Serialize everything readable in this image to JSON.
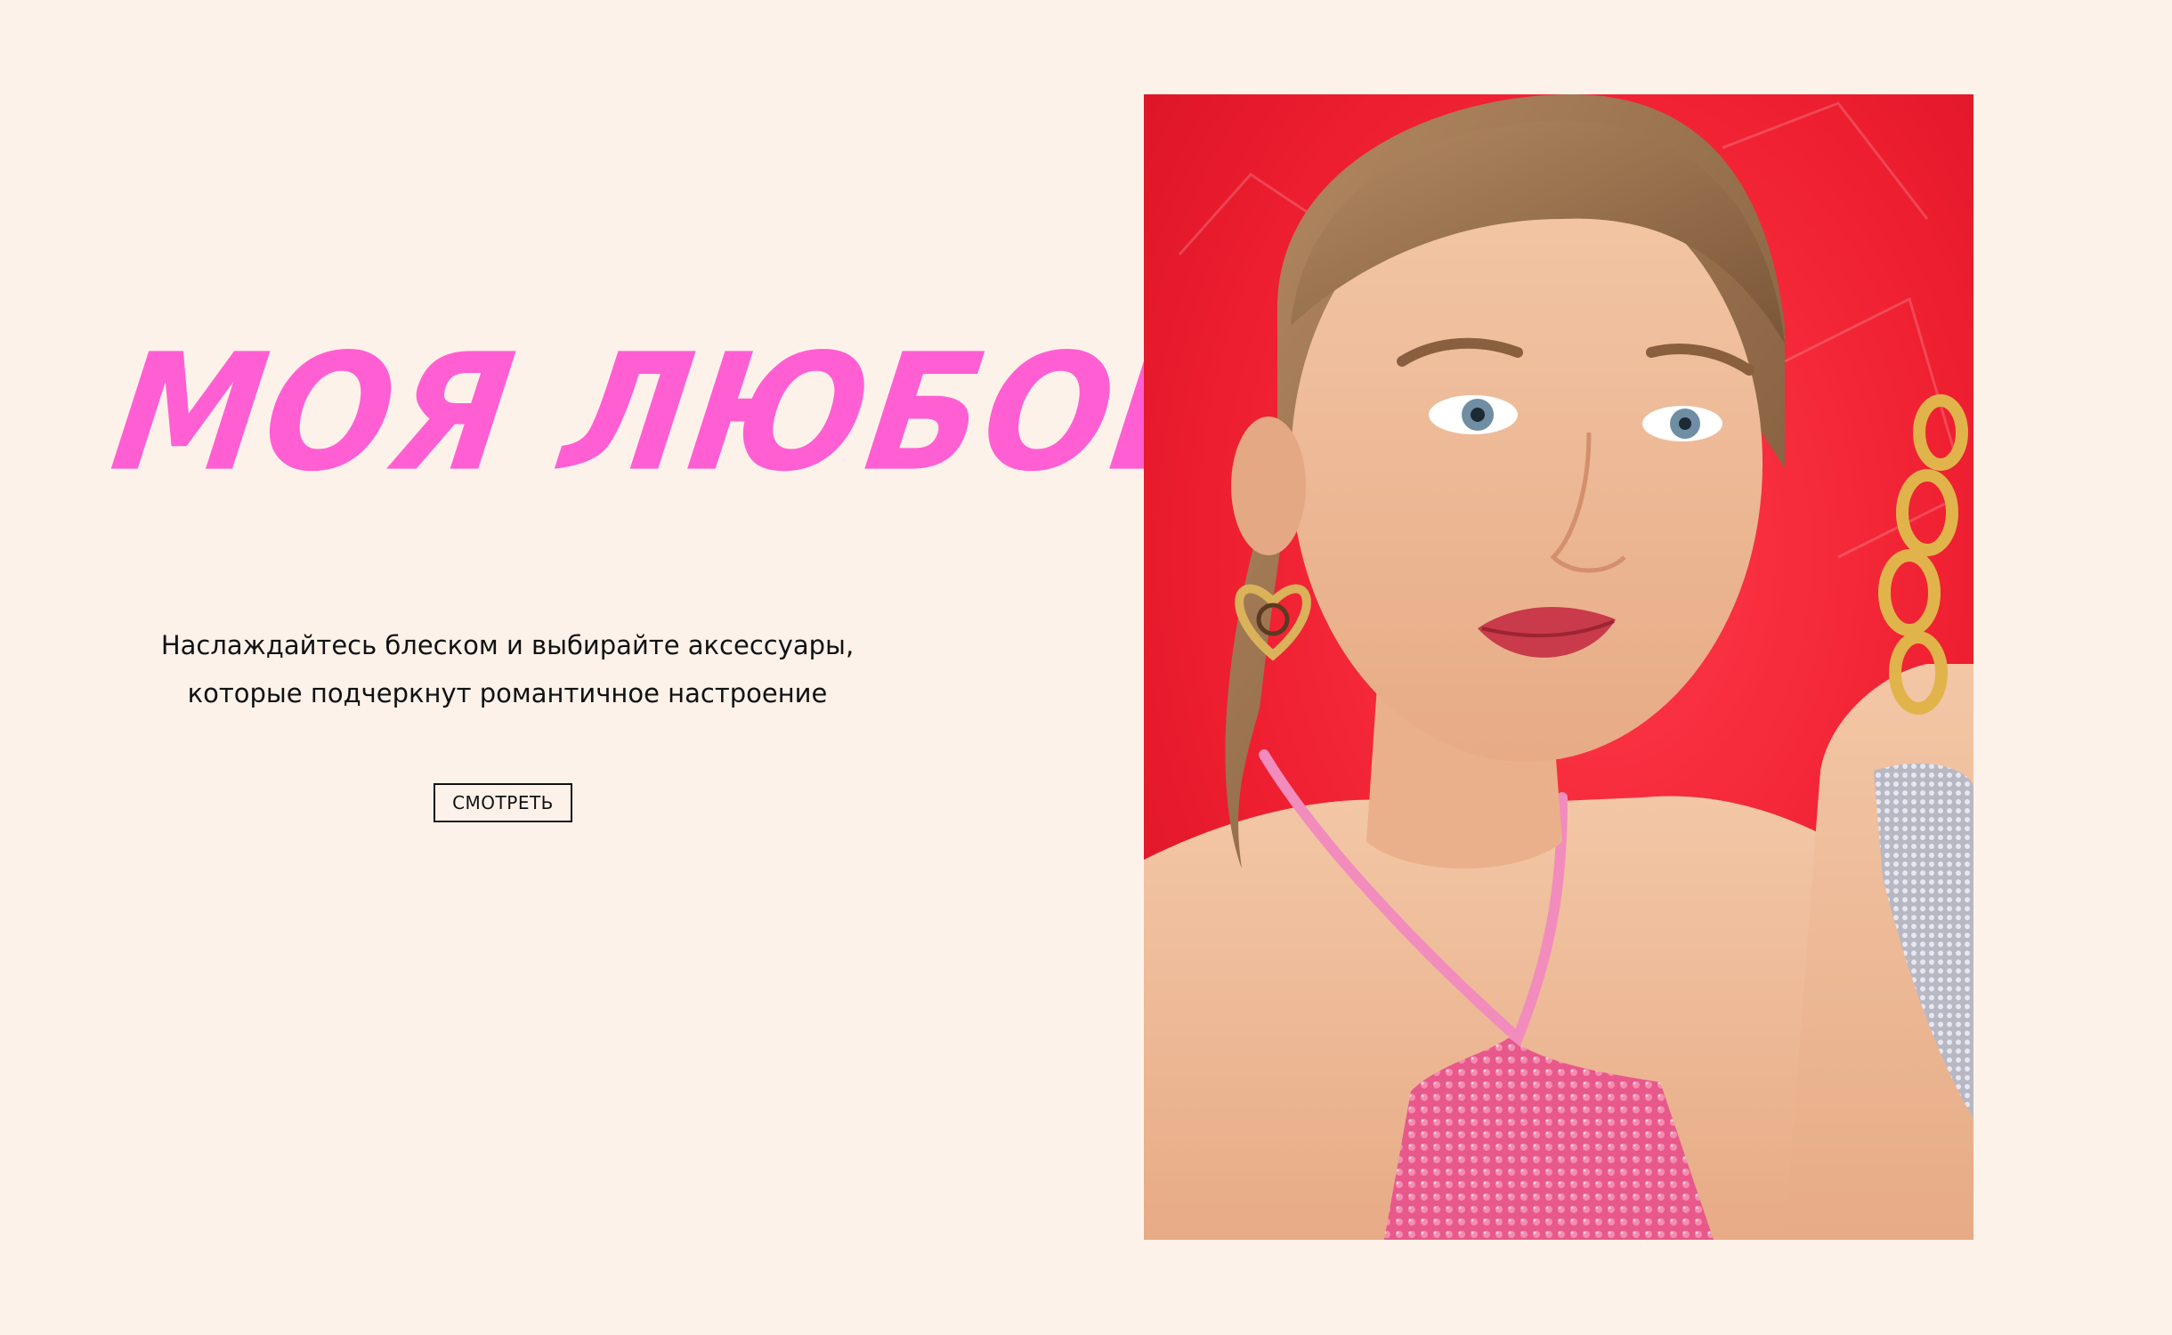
{
  "hero": {
    "title": "МОЯ ЛЮБОВЬ",
    "subtitle_line1": "Наслаждайтесь блеском и выбирайте аксессуары,",
    "subtitle_line2": "которые подчеркнут романтичное настроение",
    "cta_label": "СМОТРЕТЬ"
  },
  "colors": {
    "background": "#fdf2ea",
    "title": "#ff5fd3",
    "text": "#111111",
    "photo_backdrop": "#f02030"
  }
}
